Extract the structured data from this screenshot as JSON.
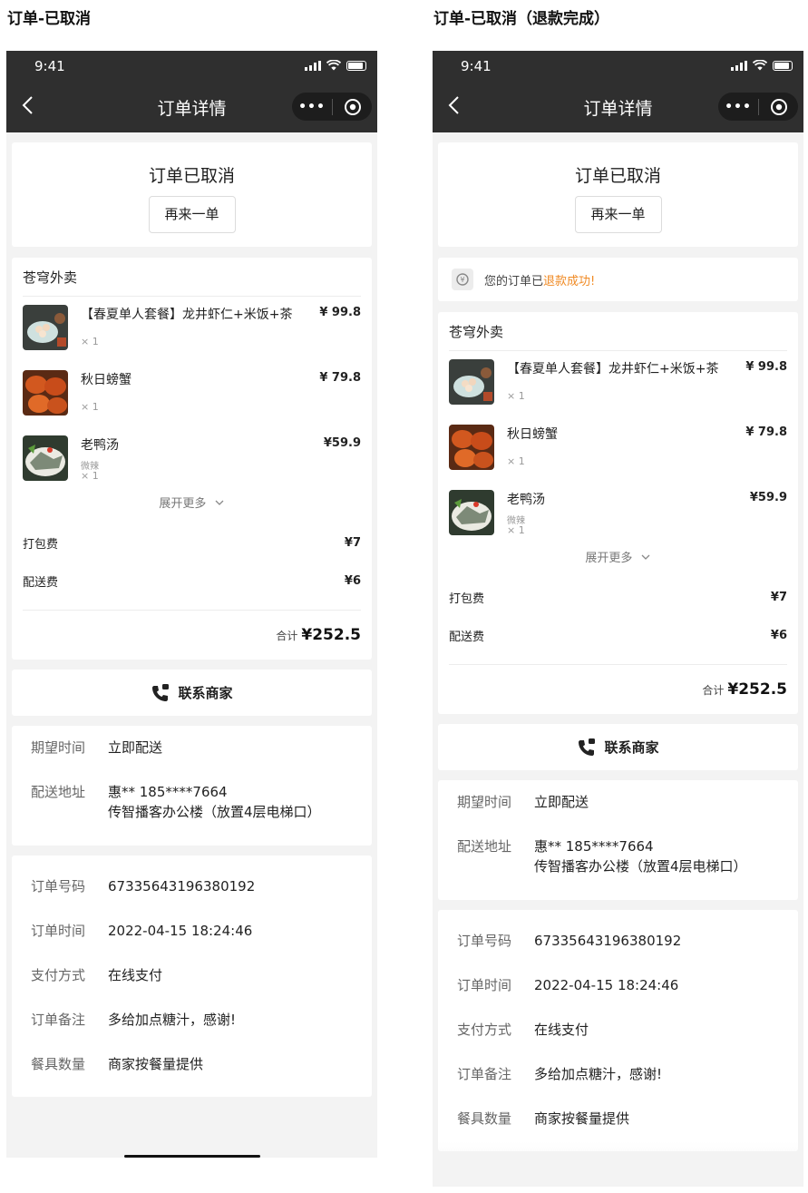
{
  "frames": [
    {
      "heading": "订单-已取消",
      "time": "9:41",
      "nav_title": "订单详情",
      "capsule_dots": "•••",
      "order_status": "订单已取消",
      "reorder_label": "再来一单",
      "shop_name": "苍穹外卖",
      "items": [
        {
          "name": "【春夏单人套餐】龙井虾仁+米饭+茶",
          "spec": "",
          "qty": "× 1",
          "price": "¥ 99.8"
        },
        {
          "name": "秋日螃蟹",
          "spec": "",
          "qty": "× 1",
          "price": "¥ 79.8"
        },
        {
          "name": "老鸭汤",
          "spec": "微辣",
          "qty": "× 1",
          "price": "¥59.9"
        }
      ],
      "expand_label": "展开更多",
      "packing_label": "打包费",
      "packing_value": "¥7",
      "delivery_label": "配送费",
      "delivery_value": "¥6",
      "total_label": "合计",
      "total_value": "¥252.5",
      "contact_label": "联系商家",
      "expect_label": "期望时间",
      "expect_value": "立即配送",
      "address_label": "配送地址",
      "address_line1": "惠** 185****7664",
      "address_line2": "传智播客办公楼（放置4层电梯口）",
      "order_no_label": "订单号码",
      "order_no_value": "67335643196380192",
      "order_time_label": "订单时间",
      "order_time_value": "2022-04-15 18:24:46",
      "pay_label": "支付方式",
      "pay_value": "在线支付",
      "remark_label": "订单备注",
      "remark_value": "多给加点糖汁，感谢!",
      "tableware_label": "餐具数量",
      "tableware_value": "商家按餐量提供"
    },
    {
      "heading": "订单-已取消（退款完成）",
      "time": "9:41",
      "nav_title": "订单详情",
      "capsule_dots": "•••",
      "order_status": "订单已取消",
      "reorder_label": "再来一单",
      "refund_prefix": "您的订单已",
      "refund_highlight": "退款成功!",
      "shop_name": "苍穹外卖",
      "items": [
        {
          "name": "【春夏单人套餐】龙井虾仁+米饭+茶",
          "spec": "",
          "qty": "× 1",
          "price": "¥ 99.8"
        },
        {
          "name": "秋日螃蟹",
          "spec": "",
          "qty": "× 1",
          "price": "¥ 79.8"
        },
        {
          "name": "老鸭汤",
          "spec": "微辣",
          "qty": "× 1",
          "price": "¥59.9"
        }
      ],
      "expand_label": "展开更多",
      "packing_label": "打包费",
      "packing_value": "¥7",
      "delivery_label": "配送费",
      "delivery_value": "¥6",
      "total_label": "合计",
      "total_value": "¥252.5",
      "contact_label": "联系商家",
      "expect_label": "期望时间",
      "expect_value": "立即配送",
      "address_label": "配送地址",
      "address_line1": "惠** 185****7664",
      "address_line2": "传智播客办公楼（放置4层电梯口）",
      "order_no_label": "订单号码",
      "order_no_value": "67335643196380192",
      "order_time_label": "订单时间",
      "order_time_value": "2022-04-15 18:24:46",
      "pay_label": "支付方式",
      "pay_value": "在线支付",
      "remark_label": "订单备注",
      "remark_value": "多给加点糖汁，感谢!",
      "tableware_label": "餐具数量",
      "tableware_value": "商家按餐量提供"
    }
  ],
  "colors": {
    "navbar": "#2f2f2f",
    "page_bg": "#f3f3f3",
    "refund_highlight": "#f08a24"
  },
  "icons": [
    "back-chevron-icon",
    "more-dots-icon",
    "mini-program-close-icon",
    "refund-icon",
    "phone-icon",
    "chevron-down-icon"
  ]
}
